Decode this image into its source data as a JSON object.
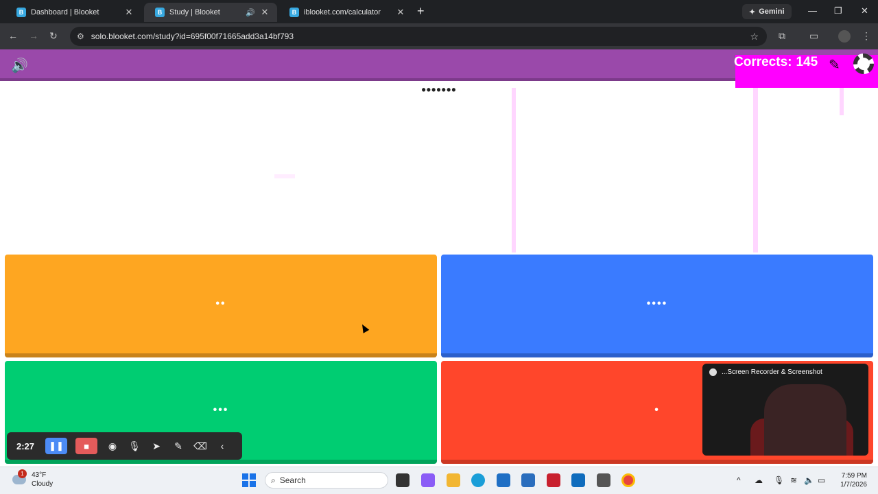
{
  "browser": {
    "tabs": [
      {
        "label": "Dashboard | Blooket",
        "favicon": "B",
        "active": false
      },
      {
        "label": "Study | Blooket",
        "favicon": "B",
        "active": true
      },
      {
        "label": "iblooket.com/calculator",
        "favicon": "B",
        "active": false
      }
    ],
    "gemini_label": "Gemini",
    "url": "solo.blooket.com/study?id=695f00f71665add3a14bf793"
  },
  "game": {
    "corrects_label": "Corrects:",
    "corrects_value": "145",
    "question_text": "•••••••",
    "answers": [
      {
        "text": "••",
        "color": "#fea621"
      },
      {
        "text": "••••",
        "color": "#3a7bff"
      },
      {
        "text": "•••",
        "color": "#00cd72"
      },
      {
        "text": "•",
        "color": "#ff462b"
      }
    ],
    "header_color": "#9a49aa"
  },
  "recorder": {
    "time": "2:27"
  },
  "webcam": {
    "title": "...Screen Recorder & Screenshot"
  },
  "taskbar": {
    "weather_temp": "43°F",
    "weather_desc": "Cloudy",
    "weather_badge": "1",
    "search_label": "Search",
    "time": "7:59 PM",
    "date": "1/7/2026"
  }
}
